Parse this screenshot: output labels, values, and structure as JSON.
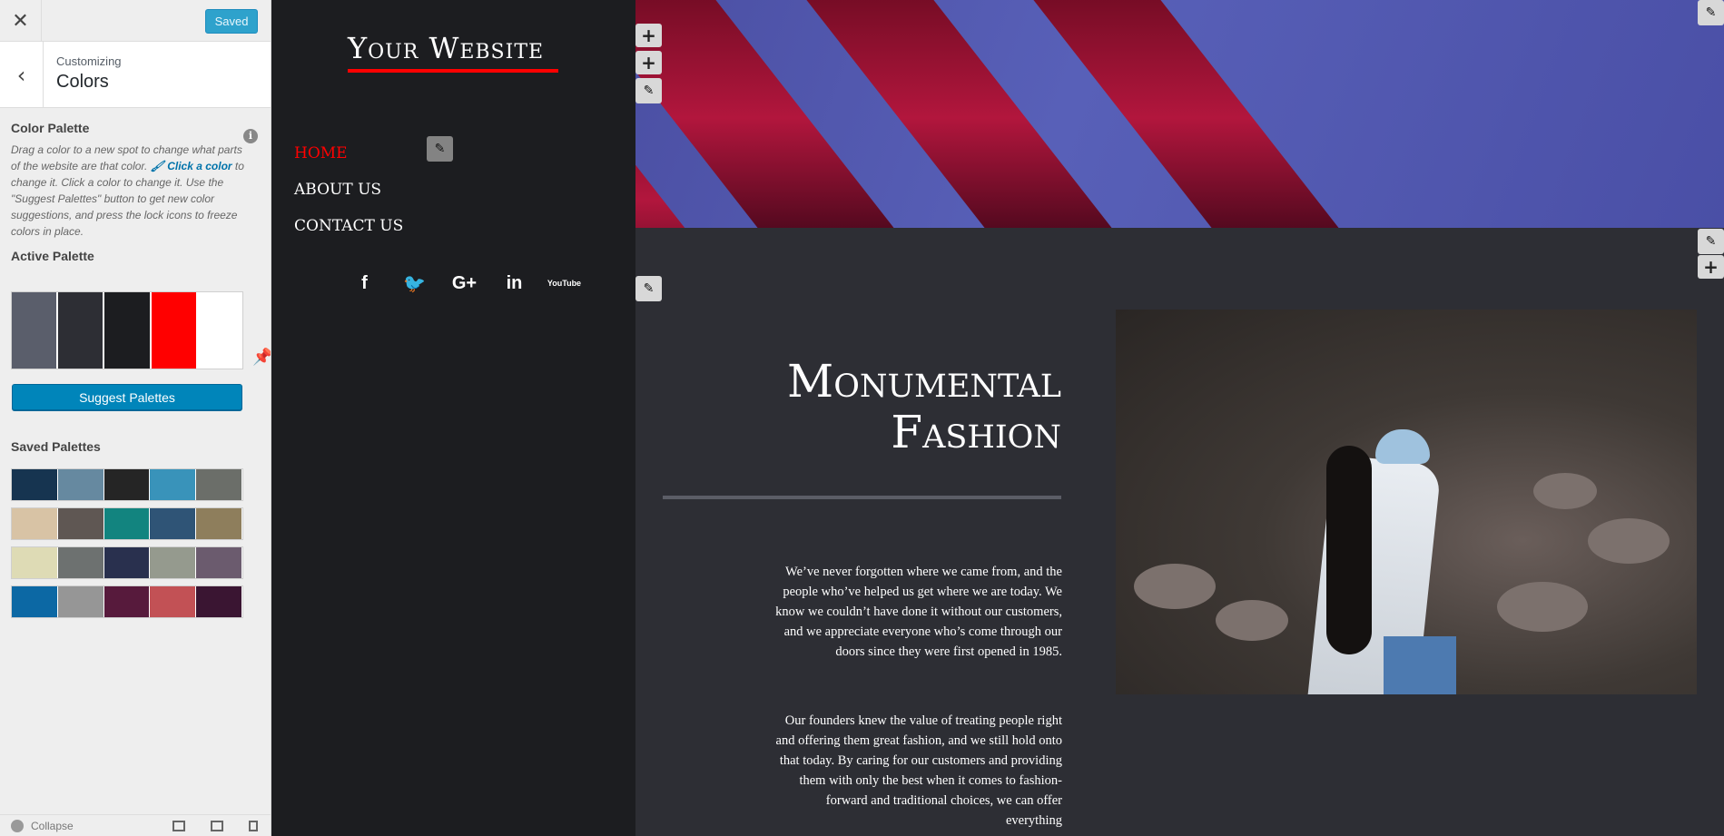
{
  "customizer": {
    "close_icon": "close-icon",
    "saved_label": "Saved",
    "back_icon": "back-icon",
    "subtitle": "Customizing",
    "title": "Colors",
    "color_palette_heading": "Color Palette",
    "info_icon": "info-icon",
    "desc_part1": "Drag a color to a new spot to change what parts of the website are that color. ",
    "desc_link": "Click a color",
    "desc_part2": " to change it. Click a color to change it. Use the \"Suggest Palettes\" button to get new color suggestions, and press the lock icons to freeze colors in place.",
    "active_palette_heading": "Active Palette",
    "active_palette": [
      "#5a5e6b",
      "#2d2e34",
      "#1c1d20",
      "#ff0000",
      "#ffffff"
    ],
    "suggest_label": "Suggest Palettes",
    "saved_palettes_heading": "Saved Palettes",
    "saved_palettes": [
      [
        "#163450",
        "#6689a0",
        "#252525",
        "#3993ba",
        "#6b6e69"
      ],
      [
        "#d8c3a5",
        "#5f5753",
        "#12847f",
        "#2f5476",
        "#8e7e5c"
      ],
      [
        "#dedbb5",
        "#6d7170",
        "#29304e",
        "#959a8e",
        "#6b5b6e"
      ],
      [
        "#0c68a4",
        "#969696",
        "#571a3c",
        "#c25155",
        "#3a1532"
      ]
    ],
    "collapse_label": "Collapse"
  },
  "site": {
    "title": "Your Website",
    "accent_color": "#ff0000",
    "nav": [
      {
        "label": "HOME",
        "active": true
      },
      {
        "label": "ABOUT US",
        "active": false
      },
      {
        "label": "CONTACT US",
        "active": false
      }
    ],
    "socials": [
      "f",
      "twitter-icon",
      "G+",
      "in",
      "YouTube"
    ]
  },
  "content": {
    "heading_line1": "Monumental",
    "heading_line2": "Fashion",
    "paragraph1": "We’ve never forgotten where we came from, and the people who’ve helped us get where we are today. We know we couldn’t have done it without our customers, and we appreciate everyone who’s come through our doors since they were first opened in 1985.",
    "paragraph2": "Our founders knew the value of treating people right and offering them great fashion, and we still hold onto that today. By caring for our customers and providing them with only the best when it comes to fashion-forward and traditional choices, we can offer everything"
  }
}
